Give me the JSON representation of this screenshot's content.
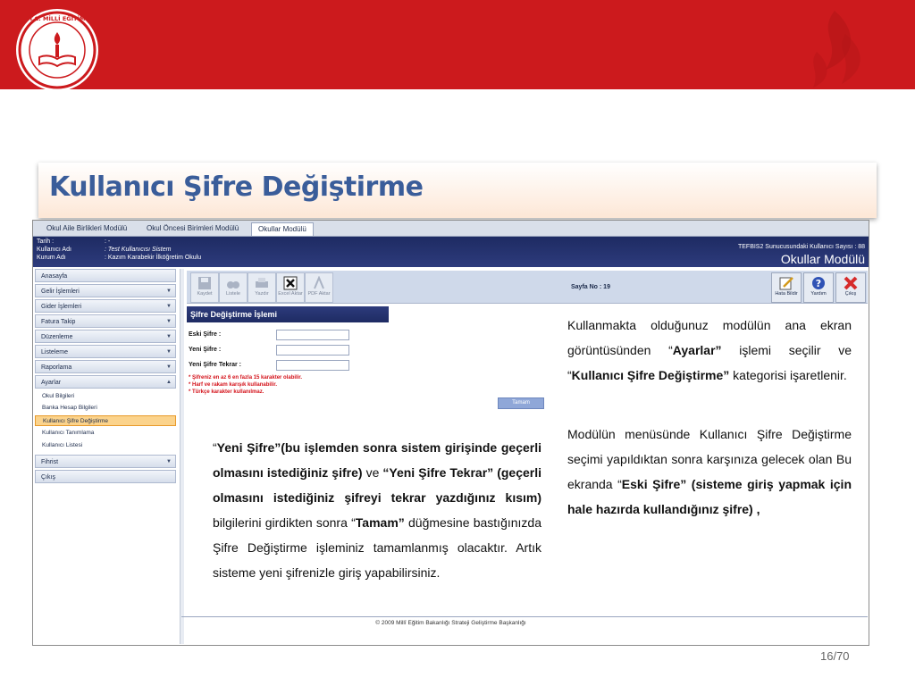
{
  "header": {
    "logo_text": "T.C. MİLLİ EĞİTİM BAKANLIĞI",
    "bar_color": "#cc1a1d"
  },
  "slide": {
    "title": "Kullanıcı Şifre Değiştirme",
    "page": "16/70"
  },
  "screenshot": {
    "tabs": [
      "Okul Aile Birlikleri Modülü",
      "Okul Öncesi Birimleri Modülü",
      "Okullar Modülü"
    ],
    "info": {
      "tarih_label": "Tarih :",
      "tarih_value": ": -",
      "user_label": "Kullanıcı Adı",
      "user_value": ": Test Kullanıcısı Sistem",
      "kurum_label": "Kurum Adı",
      "kurum_value": ": Kazım Karabekir İlköğretim Okulu",
      "server_text": "TEFBIS2 Sunucusundaki Kullanıcı Sayısı : 88",
      "module_title": "Okullar Modülü"
    },
    "sidebar": {
      "items": [
        "Anasayfa",
        "Gelir İşlemleri",
        "Gider İşlemleri",
        "Fatura Takip",
        "Düzenleme",
        "Listeleme",
        "Raporlama",
        "Ayarlar"
      ],
      "sub_items": [
        "Okul Bilgileri",
        "Banka Hesap Bilgileri",
        "Kullanıcı Şifre Değiştirme",
        "Kullanıcı Tanımlama",
        "Kullanıcı Listesi"
      ],
      "bottom_items": [
        "Fihrist",
        "Çıkış"
      ]
    },
    "toolbar": {
      "buttons": [
        "Kaydet",
        "Listele",
        "Yazdır",
        "Excel Aktar",
        "PDF Aktar"
      ],
      "page_label": "Sayfa No : 19",
      "right_buttons": [
        "Hata Bildir",
        "Yardım",
        "Çıkış"
      ]
    },
    "form": {
      "title": "Şifre Değiştirme İşlemi",
      "labels": [
        "Eski Şifre :",
        "Yeni Şifre :",
        "Yeni Şifre Tekrar :"
      ],
      "warnings": [
        "* Şifreniz en az 6 en fazla 15 karakter olabilir.",
        "* Harf ve rakam karışık kullanabilir.",
        "* Türkçe karakter kullanılmaz."
      ],
      "ok_label": "Tamam"
    },
    "footer": "© 2009 Millî Eğitim Bakanlığı  Strateji Geliştirme Başkanlığı"
  },
  "text_left": {
    "q1": "“",
    "b1": "Yeni Şifre”(bu işlemden sonra sistem girişinde geçerli olmasını istediğiniz şifre)",
    "t1": " ve ",
    "b2": "“Yeni Şifre Tekrar” (geçerli olmasını istediğiniz şifreyi tekrar yazdığınız kısım)",
    "t2": " bilgilerini girdikten sonra “",
    "b3": "Tamam”",
    "t3": " düğmesine bastığınızda Şifre Değiştirme işleminiz tamamlanmış olacaktır. Artık sisteme yeni şifrenizle giriş yapabilirsiniz."
  },
  "text_right_1": {
    "t1": "Kullanmakta olduğunuz modülün ana ekran görüntüsünden “",
    "b1": "Ayarlar”",
    "t2": " işlemi seçilir ve “",
    "b2": "Kullanıcı Şifre Değiştirme”",
    "t3": " kategorisi işaretlenir."
  },
  "text_right_2": {
    "t1": "Modülün menüsünde Kullanıcı Şifre Değiştirme seçimi yapıldıktan sonra karşınıza gelecek olan Bu ekranda “",
    "b1": "Eski Şifre” (sisteme giriş yapmak için hale hazırda kullandığınız şifre) ,"
  }
}
